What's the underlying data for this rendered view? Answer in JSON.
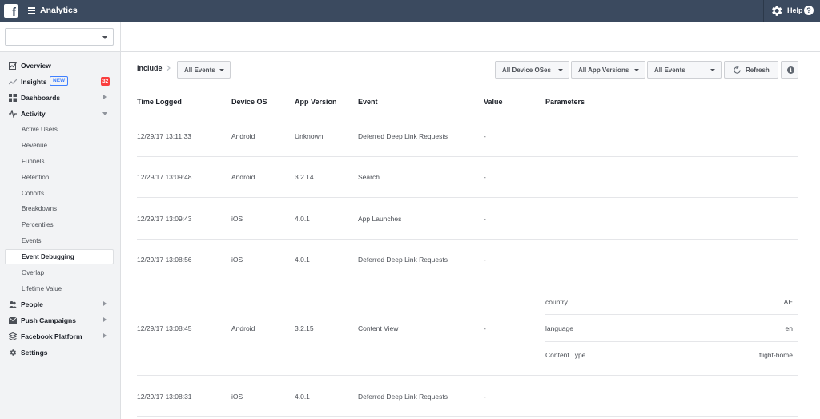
{
  "topbar": {
    "logo": "f",
    "app_title": "Analytics",
    "help_label": "Help",
    "help_icon": "?"
  },
  "app_selector": {
    "value": ""
  },
  "sidebar": {
    "items": [
      {
        "label": "Overview",
        "icon": "overview-icon"
      },
      {
        "label": "Insights",
        "icon": "insights-icon",
        "badge": "NEW",
        "count": "32"
      },
      {
        "label": "Dashboards",
        "icon": "dashboards-icon"
      },
      {
        "label": "Activity",
        "icon": "activity-icon"
      },
      {
        "label": "People",
        "icon": "people-icon"
      },
      {
        "label": "Push Campaigns",
        "icon": "push-campaigns-icon"
      },
      {
        "label": "Facebook Platform",
        "icon": "facebook-platform-icon"
      },
      {
        "label": "Settings",
        "icon": "settings-icon"
      }
    ],
    "activity_sub": [
      "Active Users",
      "Revenue",
      "Funnels",
      "Retention",
      "Cohorts",
      "Breakdowns",
      "Percentiles",
      "Events",
      "Event Debugging",
      "Overlap",
      "Lifetime Value"
    ],
    "active_sub": "Event Debugging"
  },
  "toolbar": {
    "include_label": "Include",
    "include_filter": "All Events",
    "device_os_filter": "All Device OSes",
    "app_versions_filter": "All App Versions",
    "events_filter": "All Events",
    "refresh_label": "Refresh",
    "info_icon": "i"
  },
  "table": {
    "headers": [
      "Time Logged",
      "Device OS",
      "App Version",
      "Event",
      "Value",
      "Parameters"
    ],
    "rows": [
      {
        "time": "12/29/17 13:11:33",
        "os": "Android",
        "version": "Unknown",
        "event": "Deferred Deep Link Requests",
        "value": "-"
      },
      {
        "time": "12/29/17 13:09:48",
        "os": "Android",
        "version": "3.2.14",
        "event": "Search",
        "value": "-"
      },
      {
        "time": "12/29/17 13:09:43",
        "os": "iOS",
        "version": "4.0.1",
        "event": "App Launches",
        "value": "-"
      },
      {
        "time": "12/29/17 13:08:56",
        "os": "iOS",
        "version": "4.0.1",
        "event": "Deferred Deep Link Requests",
        "value": "-"
      },
      {
        "time": "12/29/17 13:08:45",
        "os": "Android",
        "version": "3.2.15",
        "event": "Content View",
        "value": "-",
        "parameters": [
          {
            "key": "country",
            "value": "AE"
          },
          {
            "key": "language",
            "value": "en"
          },
          {
            "key": "Content Type",
            "value": "flight-home"
          }
        ]
      },
      {
        "time": "12/29/17 13:08:31",
        "os": "iOS",
        "version": "4.0.1",
        "event": "Deferred Deep Link Requests",
        "value": "-"
      }
    ]
  },
  "colors": {
    "topbar": "#3b4a5f",
    "sidebar_bg": "#f2f3f5",
    "badge_red": "#fa3e3e",
    "badge_blue": "#4080ff"
  }
}
